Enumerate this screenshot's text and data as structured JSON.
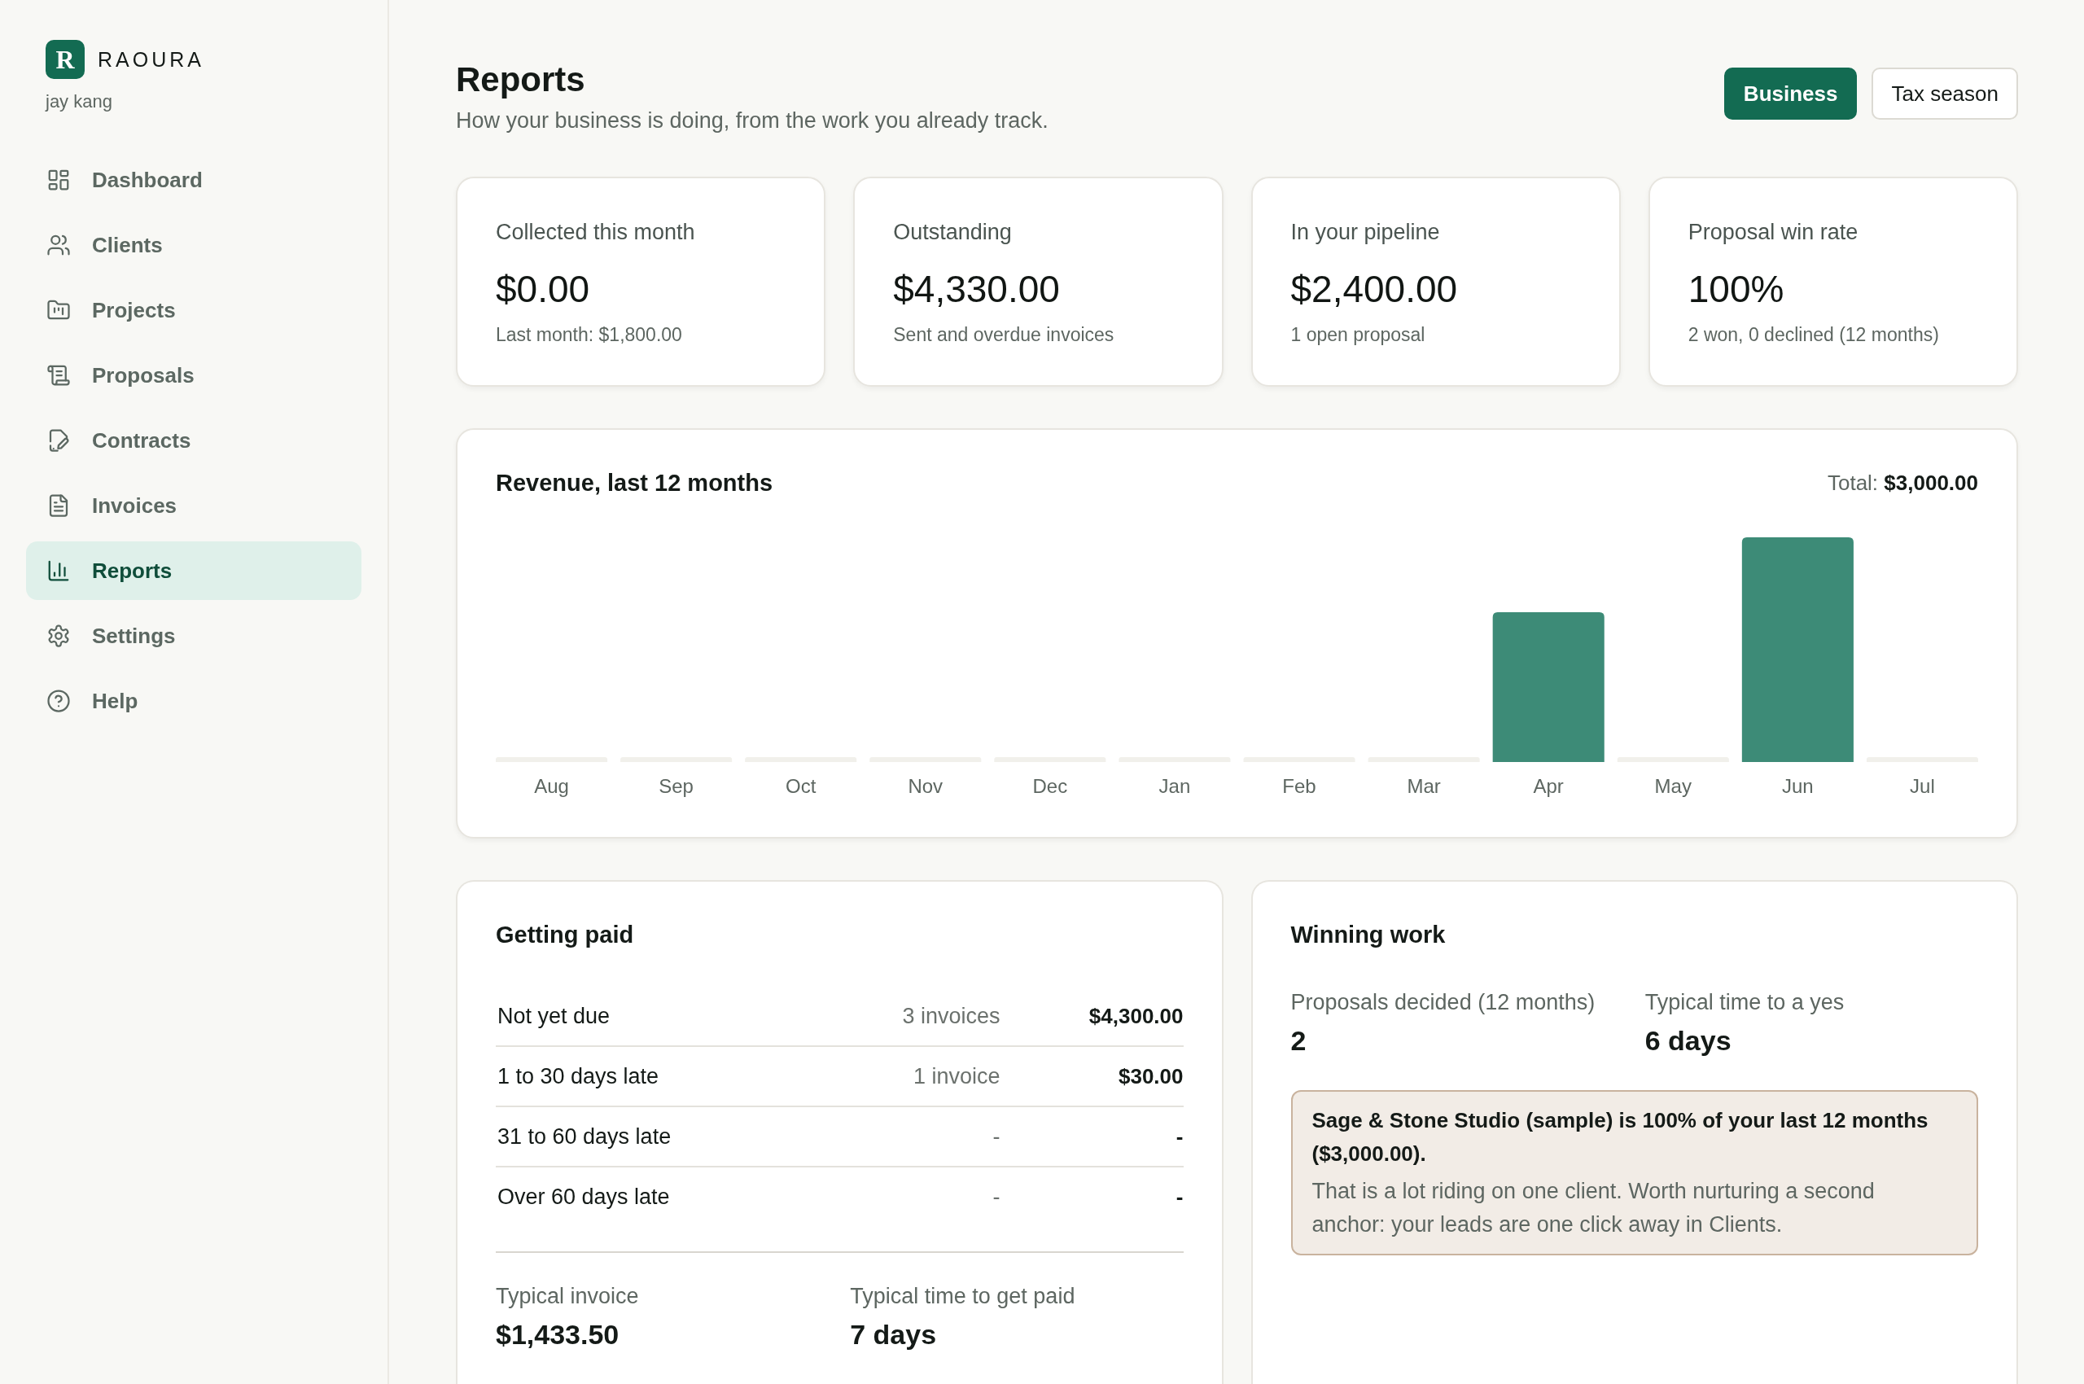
{
  "sidebar": {
    "brand": {
      "logo_letter": "R",
      "name": "RAOURA"
    },
    "user": "jay kang",
    "items": [
      {
        "label": "Dashboard",
        "selected": false
      },
      {
        "label": "Clients",
        "selected": false
      },
      {
        "label": "Projects",
        "selected": false
      },
      {
        "label": "Proposals",
        "selected": false
      },
      {
        "label": "Contracts",
        "selected": false
      },
      {
        "label": "Invoices",
        "selected": false
      },
      {
        "label": "Reports",
        "selected": true
      },
      {
        "label": "Settings",
        "selected": false
      },
      {
        "label": "Help",
        "selected": false
      }
    ]
  },
  "header": {
    "title": "Reports",
    "subtitle": "How your business is doing, from the work you already track.",
    "view_toggle": [
      {
        "label": "Business",
        "selected": true
      },
      {
        "label": "Tax season",
        "selected": false
      }
    ]
  },
  "stats": [
    {
      "label": "Collected this month",
      "value": "$0.00",
      "note": "Last month: $1,800.00"
    },
    {
      "label": "Outstanding",
      "value": "$4,330.00",
      "note": "Sent and overdue invoices"
    },
    {
      "label": "In your pipeline",
      "value": "$2,400.00",
      "note": "1 open proposal"
    },
    {
      "label": "Proposal win rate",
      "value": "100%",
      "note": "2 won, 0 declined (12 months)"
    }
  ],
  "revenue": {
    "title": "Revenue, last 12 months",
    "total": "Total: **$3,000.00**",
    "months": [
      "Aug",
      "Sep",
      "Oct",
      "Nov",
      "Dec",
      "Jan",
      "Feb",
      "Mar",
      "Apr",
      "May",
      "Jun",
      "Jul"
    ]
  },
  "getting_paid": {
    "title": "Getting paid",
    "rows": [
      {
        "label": "Not yet due",
        "count": "3 invoices",
        "amount": "$4,300.00"
      },
      {
        "label": "1 to 30 days late",
        "count": "1 invoice",
        "amount": "$30.00"
      },
      {
        "label": "31 to 60 days late",
        "count": "-",
        "amount": "-"
      },
      {
        "label": "Over 60 days late",
        "count": "-",
        "amount": "-"
      }
    ],
    "summary": [
      {
        "label": "Typical invoice",
        "value": "$1,433.50"
      },
      {
        "label": "Typical time to get paid",
        "value": "7 days"
      }
    ]
  },
  "winning_work": {
    "title": "Winning work",
    "summary": [
      {
        "label": "Proposals decided (12 months)",
        "value": "2"
      },
      {
        "label": "Typical time to a yes",
        "value": "6 days"
      }
    ],
    "callout": {
      "headline": "Sage & Stone Studio (sample) is 100% of your last 12 months ($3,000.00).",
      "body": "That is a lot riding on one client. Worth nurturing a second anchor: your leads are one click away in Clients."
    }
  }
}
